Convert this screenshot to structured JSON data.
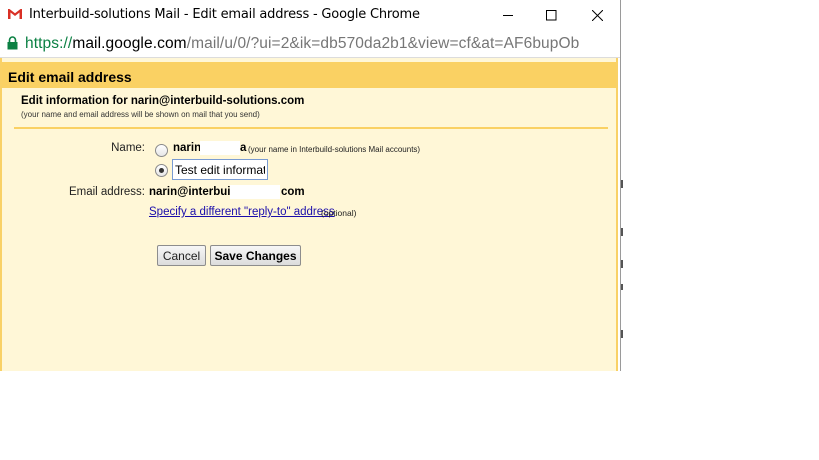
{
  "window": {
    "title": "Interbuild-solutions Mail - Edit email address - Google Chrome",
    "controls": {
      "minimize": "minimize",
      "maximize": "maximize",
      "close": "close"
    }
  },
  "address_bar": {
    "scheme": "https://",
    "host": "mail.google.com",
    "path": "/mail/u/0/?ui=2&ik=db570da2b1&view=cf&at=AF6bupOb"
  },
  "page": {
    "heading": "Edit email address",
    "info_title": "Edit information for narin@interbuild-solutions.com",
    "info_note": "(your name and email address will be shown on mail that you send)",
    "name_label": "Name:",
    "name_option_1": {
      "value": "narin",
      "tail": "a",
      "note": "(your name in Interbuild-solutions Mail accounts)",
      "selected": false
    },
    "name_option_2": {
      "input_value": "Test edit information",
      "selected": true
    },
    "email_label": "Email address:",
    "email_value": "narin@interbuild",
    "email_tail": "com",
    "reply_to_link": "Specify a different \"reply-to\" address",
    "reply_to_optional": "(optional)",
    "buttons": {
      "cancel": "Cancel",
      "save": "Save Changes"
    }
  },
  "colors": {
    "header_bg": "#fad163",
    "page_bg": "#fff7d7",
    "link": "#1a0dab",
    "url_scheme": "#0b8043"
  }
}
